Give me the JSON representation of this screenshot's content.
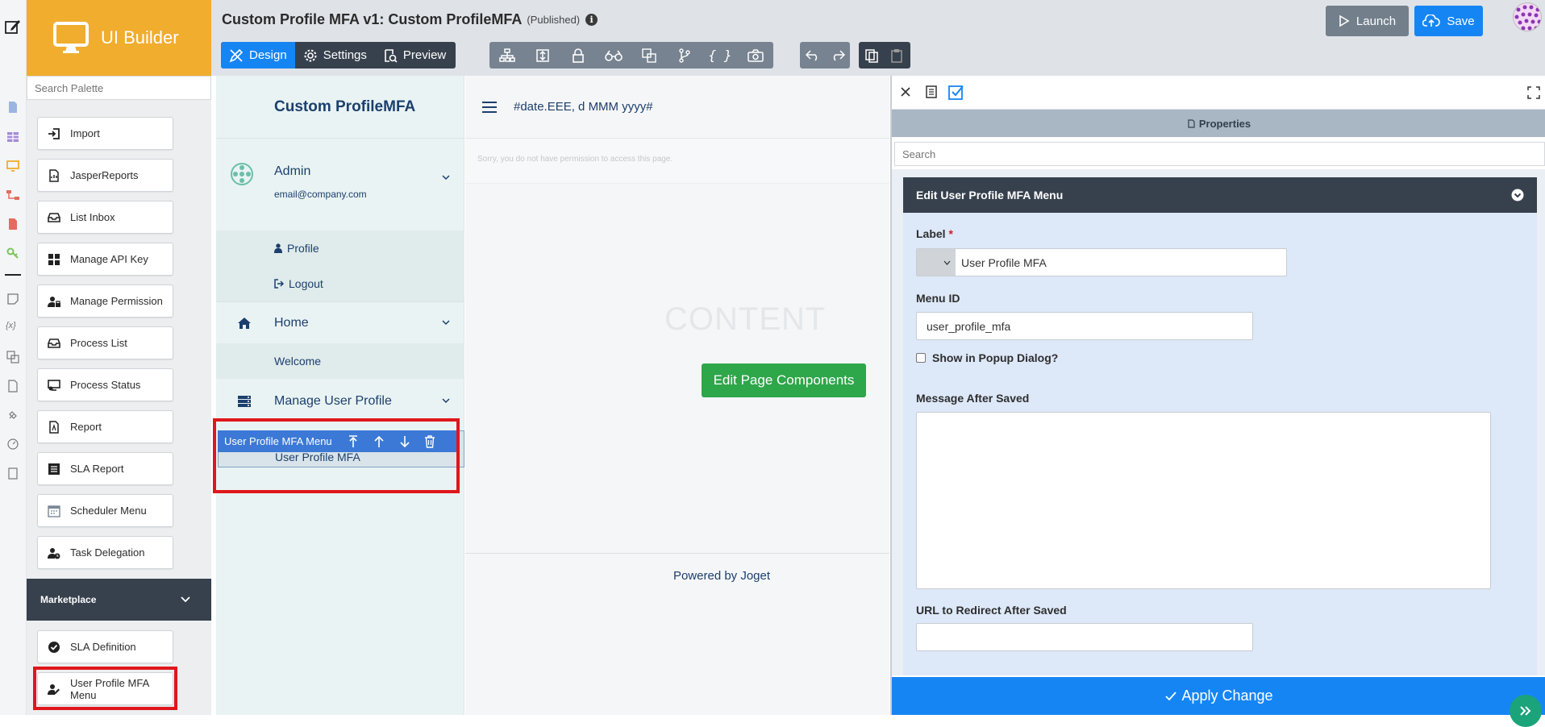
{
  "brand": {
    "name": "UI Builder"
  },
  "palette": {
    "search_placeholder": "Search Palette",
    "items": [
      {
        "label": "Import",
        "icon": "import-icon"
      },
      {
        "label": "JasperReports",
        "icon": "report-file-icon"
      },
      {
        "label": "List Inbox",
        "icon": "inbox-icon"
      },
      {
        "label": "Manage API Key",
        "icon": "grid-icon"
      },
      {
        "label": "Manage Permission",
        "icon": "user-lock-icon"
      },
      {
        "label": "Process List",
        "icon": "inbox-icon"
      },
      {
        "label": "Process Status",
        "icon": "display-status-icon"
      },
      {
        "label": "Report",
        "icon": "pdf-file-icon"
      },
      {
        "label": "SLA Report",
        "icon": "list-icon"
      },
      {
        "label": "Scheduler Menu",
        "icon": "calendar-icon"
      },
      {
        "label": "Task Delegation",
        "icon": "user-clock-icon"
      }
    ],
    "section": "Marketplace",
    "market_items": [
      {
        "label": "SLA Definition",
        "icon": "check-circle-icon"
      },
      {
        "label": "User Profile MFA Menu",
        "icon": "user-edit-icon"
      }
    ]
  },
  "header": {
    "title": "Custom Profile MFA v1: Custom ProfileMFA",
    "status": "(Published)",
    "tabs": {
      "design": "Design",
      "settings": "Settings",
      "preview": "Preview"
    },
    "launch": "Launch",
    "save": "Save"
  },
  "canvas": {
    "brand_title": "Custom ProfileMFA",
    "user": {
      "name": "Admin",
      "email": "email@company.com"
    },
    "user_menu": {
      "profile": "Profile",
      "logout": "Logout"
    },
    "nav": {
      "home": "Home",
      "welcome": "Welcome",
      "manage_user_profile": "Manage User Profile",
      "selected_toolbar": "User Profile MFA Menu",
      "selected_item": "User Profile MFA"
    },
    "date_format": "#date.EEE, d MMM yyyy#",
    "no_permission": "Sorry, you do not have permission to access this page.",
    "content_placeholder": "CONTENT",
    "edit_components": "Edit Page Components",
    "footer": "Powered by Joget"
  },
  "properties": {
    "title": "Properties",
    "search_placeholder": "Search",
    "card_title": "Edit User Profile MFA Menu",
    "fields": {
      "label": {
        "label": "Label",
        "required": "*",
        "value": "User Profile MFA"
      },
      "menu_id": {
        "label": "Menu ID",
        "value": "user_profile_mfa"
      },
      "popup": {
        "label": "Show in Popup Dialog?"
      },
      "message_after_saved": {
        "label": "Message After Saved",
        "value": ""
      },
      "redirect_url": {
        "label": "URL to Redirect After Saved",
        "value": ""
      }
    },
    "apply": "Apply Change"
  },
  "colors": {
    "brand": "#f0ad2e",
    "primary": "#1685f4",
    "dark": "#37414d",
    "success": "#2ea64a",
    "highlight": "#e0161c"
  }
}
